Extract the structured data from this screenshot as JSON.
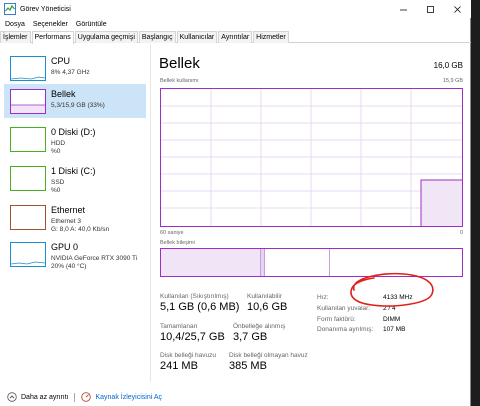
{
  "window": {
    "title": "Görev Yöneticisi"
  },
  "menu": [
    "Dosya",
    "Seçenekler",
    "Görüntüle"
  ],
  "tabs": [
    {
      "label": "İşlemler",
      "active": false
    },
    {
      "label": "Performans",
      "active": true
    },
    {
      "label": "Uygulama geçmişi",
      "active": false
    },
    {
      "label": "Başlangıç",
      "active": false
    },
    {
      "label": "Kullanıcılar",
      "active": false
    },
    {
      "label": "Ayrıntılar",
      "active": false
    },
    {
      "label": "Hizmetler",
      "active": false
    }
  ],
  "sidebar": {
    "items": [
      {
        "title": "CPU",
        "sub1": "8% 4,37 GHz",
        "sub2": "",
        "color": "#1a8ed3"
      },
      {
        "title": "Bellek",
        "sub1": "5,3/15,9 GB (33%)",
        "sub2": "",
        "color": "#9b2ec6"
      },
      {
        "title": "0 Diski (D:)",
        "sub1": "HDD",
        "sub2": "%0",
        "color": "#4caf20"
      },
      {
        "title": "1 Diski (C:)",
        "sub1": "SSD",
        "sub2": "%0",
        "color": "#4caf20"
      },
      {
        "title": "Ethernet",
        "sub1": "Ethernet 3",
        "sub2": "G: 8,0 A: 40,0 Kb/sn",
        "color": "#a0522d"
      },
      {
        "title": "GPU 0",
        "sub1": "NVIDIA GeForce RTX 3090 Ti",
        "sub2": "20% (40 °C)",
        "color": "#1a8ed3"
      }
    ]
  },
  "main": {
    "heading": "Bellek",
    "total": "16,0 GB",
    "usage_label": "Bellek kullanımı",
    "usage_max": "15,9 GB",
    "time_left": "60 saniye",
    "time_right": "0",
    "composition_label": "Bellek bileşimi",
    "accent_color": "#9b2ec6",
    "stats": {
      "in_use_label": "Kullanılan (Sıkıştırılmış)",
      "in_use_value": "5,1 GB (0,6 MB)",
      "available_label": "Kullanılabilir",
      "available_value": "10,6 GB",
      "committed_label": "Tamamlanan",
      "committed_value": "10,4/25,7 GB",
      "cached_label": "Önbelleğe alınmış",
      "cached_value": "3,7 GB",
      "paged_label": "Disk belleği havuzu",
      "paged_value": "241 MB",
      "nonpaged_label": "Disk belleği olmayan havuz",
      "nonpaged_value": "385 MB"
    },
    "details": [
      {
        "k": "Hız:",
        "v": "4133 MHz"
      },
      {
        "k": "Kullanılan yuvalar:",
        "v": "2 / 4"
      },
      {
        "k": "Form faktörü:",
        "v": "DIMM"
      },
      {
        "k": "Donanıma ayrılmış:",
        "v": "107 MB"
      }
    ],
    "annotation_color": "#e0201b"
  },
  "footer": {
    "less_details": "Daha az ayrıntı",
    "resource_monitor": "Kaynak İzleyicisini Aç"
  }
}
